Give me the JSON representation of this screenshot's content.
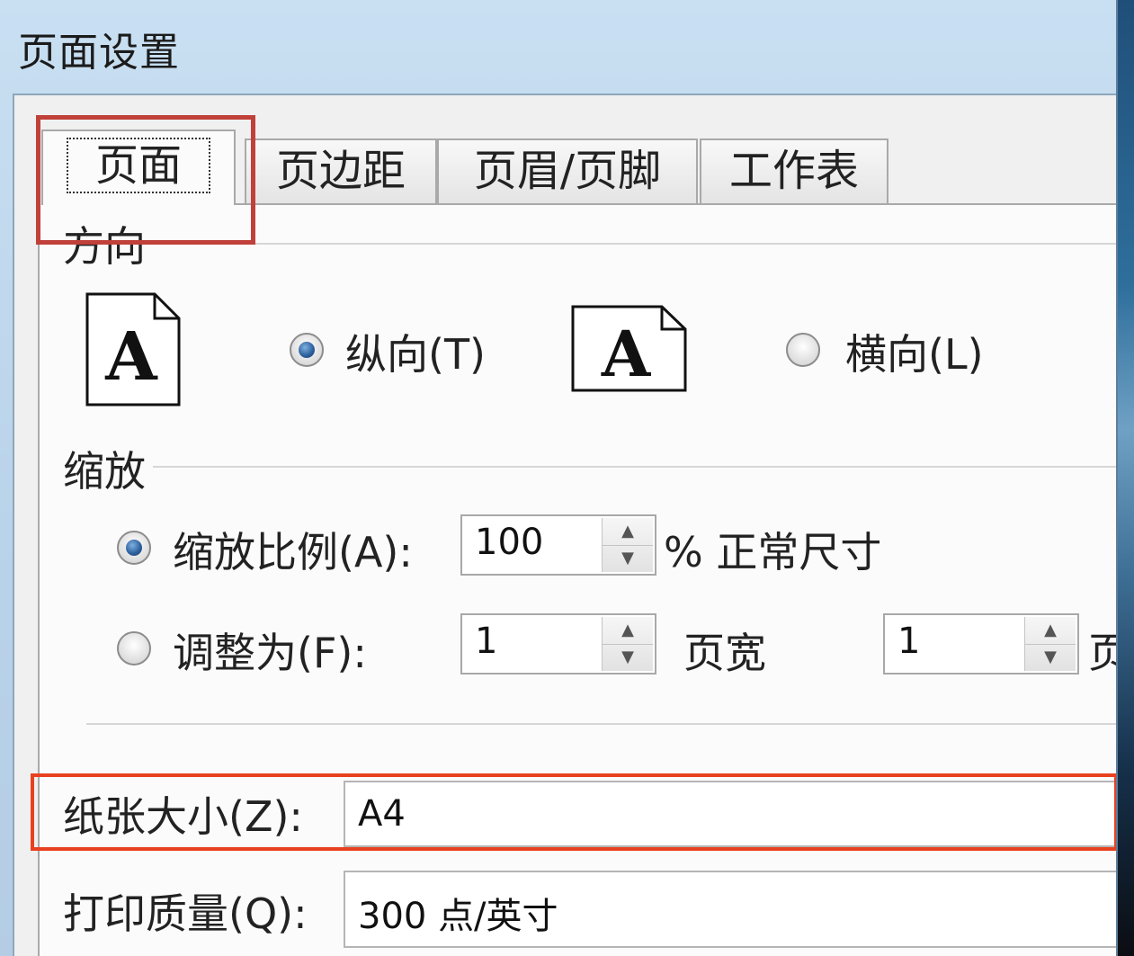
{
  "window": {
    "title": "页面设置"
  },
  "tabs": [
    {
      "label": "页面",
      "active": true
    },
    {
      "label": "页边距",
      "active": false
    },
    {
      "label": "页眉/页脚",
      "active": false
    },
    {
      "label": "工作表",
      "active": false
    }
  ],
  "orientation": {
    "heading": "方向",
    "portrait_label": "纵向(T)",
    "portrait_selected": true,
    "landscape_label": "横向(L)",
    "landscape_selected": false,
    "icon_letter": "A"
  },
  "scaling": {
    "heading": "缩放",
    "scale_label": "缩放比例(A):",
    "scale_selected": true,
    "scale_value": "100",
    "scale_suffix": "% 正常尺寸",
    "fit_label": "调整为(F):",
    "fit_selected": false,
    "fit_width_value": "1",
    "fit_width_suffix": "页宽",
    "fit_height_value": "1",
    "fit_height_suffix_partial": "页"
  },
  "paper": {
    "size_label": "纸张大小(Z):",
    "size_value": "A4",
    "quality_label": "打印质量(Q):",
    "quality_value": "300 点/英寸"
  },
  "colors": {
    "tab_highlight": "#c0403a",
    "paper_highlight": "#e8411f",
    "radio_selected": "#2a5d9a"
  }
}
